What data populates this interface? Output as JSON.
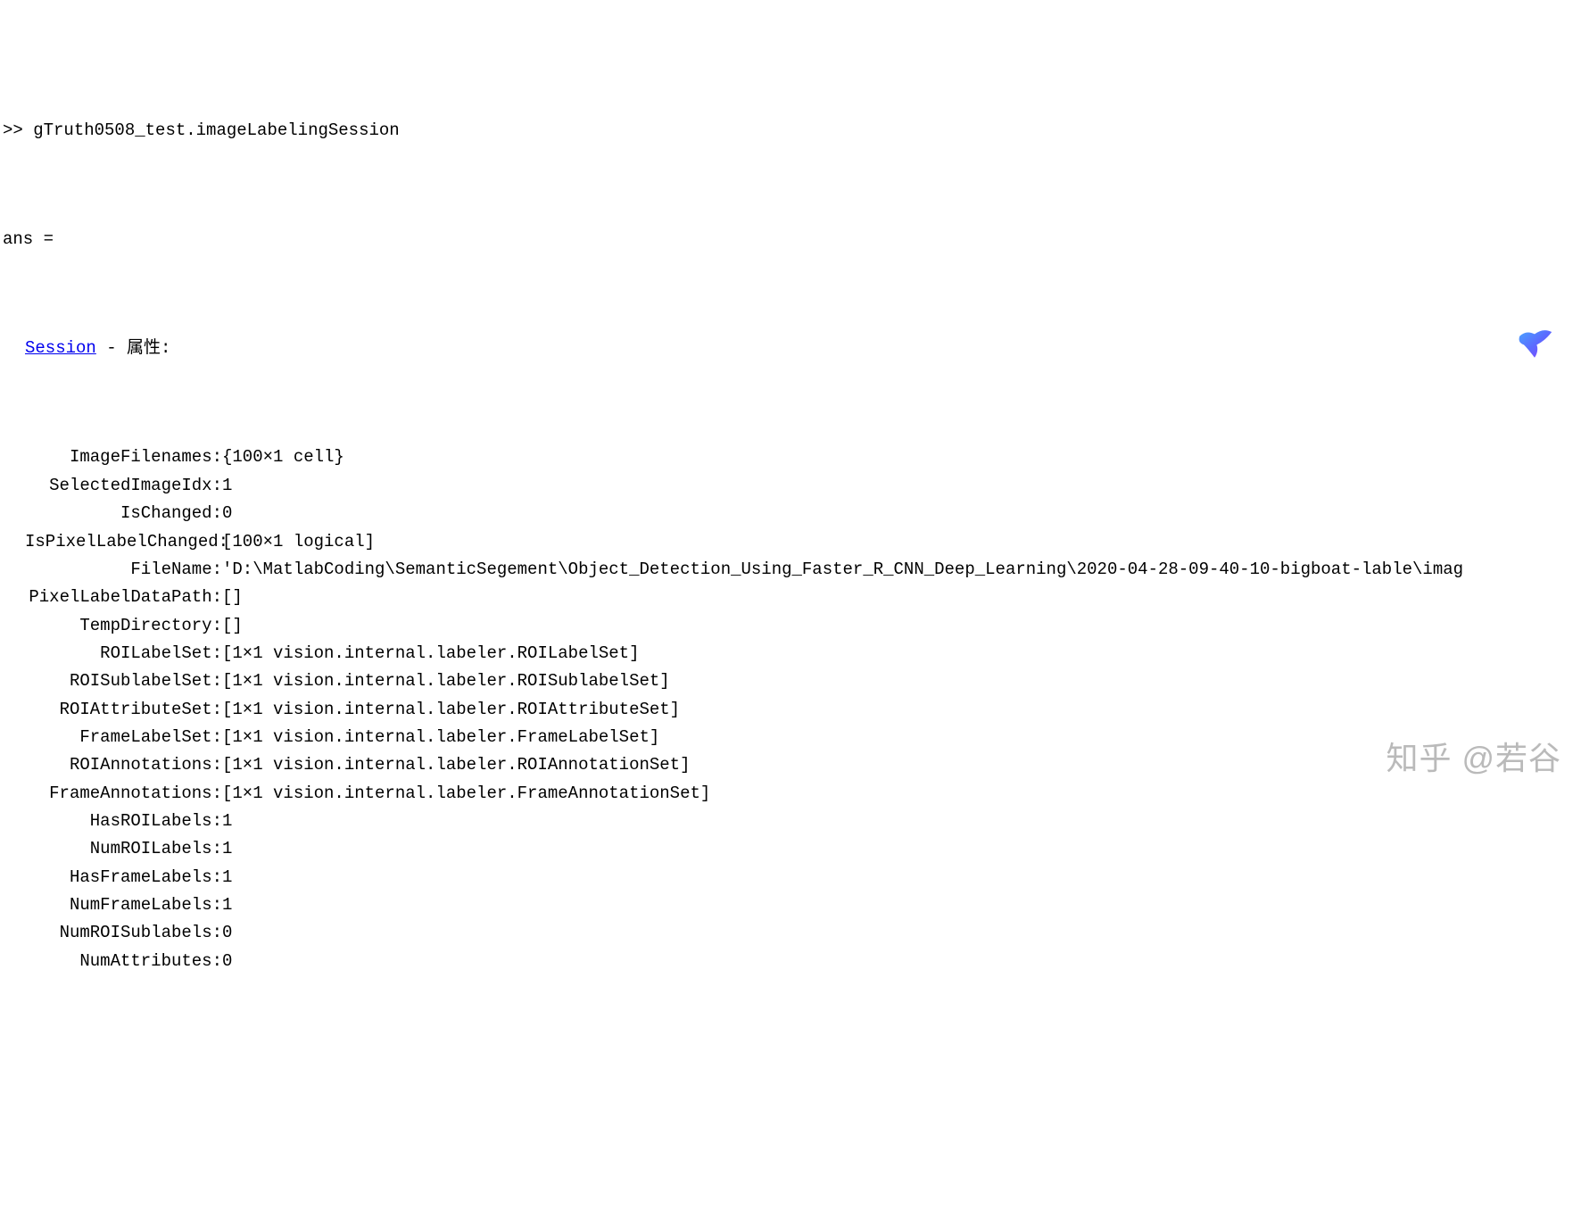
{
  "prompt": ">> ",
  "command": "gTruth0508_test.imageLabelingSession",
  "ans_label": "ans =",
  "session_link": "Session",
  "session_suffix": " - 属性:",
  "properties": [
    {
      "name": "ImageFilenames:",
      "value": " {100×1 cell}"
    },
    {
      "name": "SelectedImageIdx:",
      "value": " 1"
    },
    {
      "name": "IsChanged:",
      "value": " 0"
    },
    {
      "name": "IsPixelLabelChanged:",
      "value": " [100×1 logical]"
    },
    {
      "name": "FileName:",
      "value": " 'D:\\MatlabCoding\\SemanticSegement\\Object_Detection_Using_Faster_R_CNN_Deep_Learning\\2020-04-28-09-40-10-bigboat-lable\\imag"
    },
    {
      "name": "PixelLabelDataPath:",
      "value": " []"
    },
    {
      "name": "TempDirectory:",
      "value": " []"
    },
    {
      "name": "ROILabelSet:",
      "value": " [1×1 vision.internal.labeler.ROILabelSet]"
    },
    {
      "name": "ROISublabelSet:",
      "value": " [1×1 vision.internal.labeler.ROISublabelSet]"
    },
    {
      "name": "ROIAttributeSet:",
      "value": " [1×1 vision.internal.labeler.ROIAttributeSet]"
    },
    {
      "name": "FrameLabelSet:",
      "value": " [1×1 vision.internal.labeler.FrameLabelSet]"
    },
    {
      "name": "ROIAnnotations:",
      "value": " [1×1 vision.internal.labeler.ROIAnnotationSet]"
    },
    {
      "name": "FrameAnnotations:",
      "value": " [1×1 vision.internal.labeler.FrameAnnotationSet]"
    },
    {
      "name": "HasROILabels:",
      "value": " 1"
    },
    {
      "name": "NumROILabels:",
      "value": " 1"
    },
    {
      "name": "HasFrameLabels:",
      "value": " 1"
    },
    {
      "name": "NumFrameLabels:",
      "value": " 1"
    },
    {
      "name": "NumROISublabels:",
      "value": " 0"
    },
    {
      "name": "NumAttributes:",
      "value": " 0"
    }
  ],
  "watermark": "知乎 @若谷"
}
